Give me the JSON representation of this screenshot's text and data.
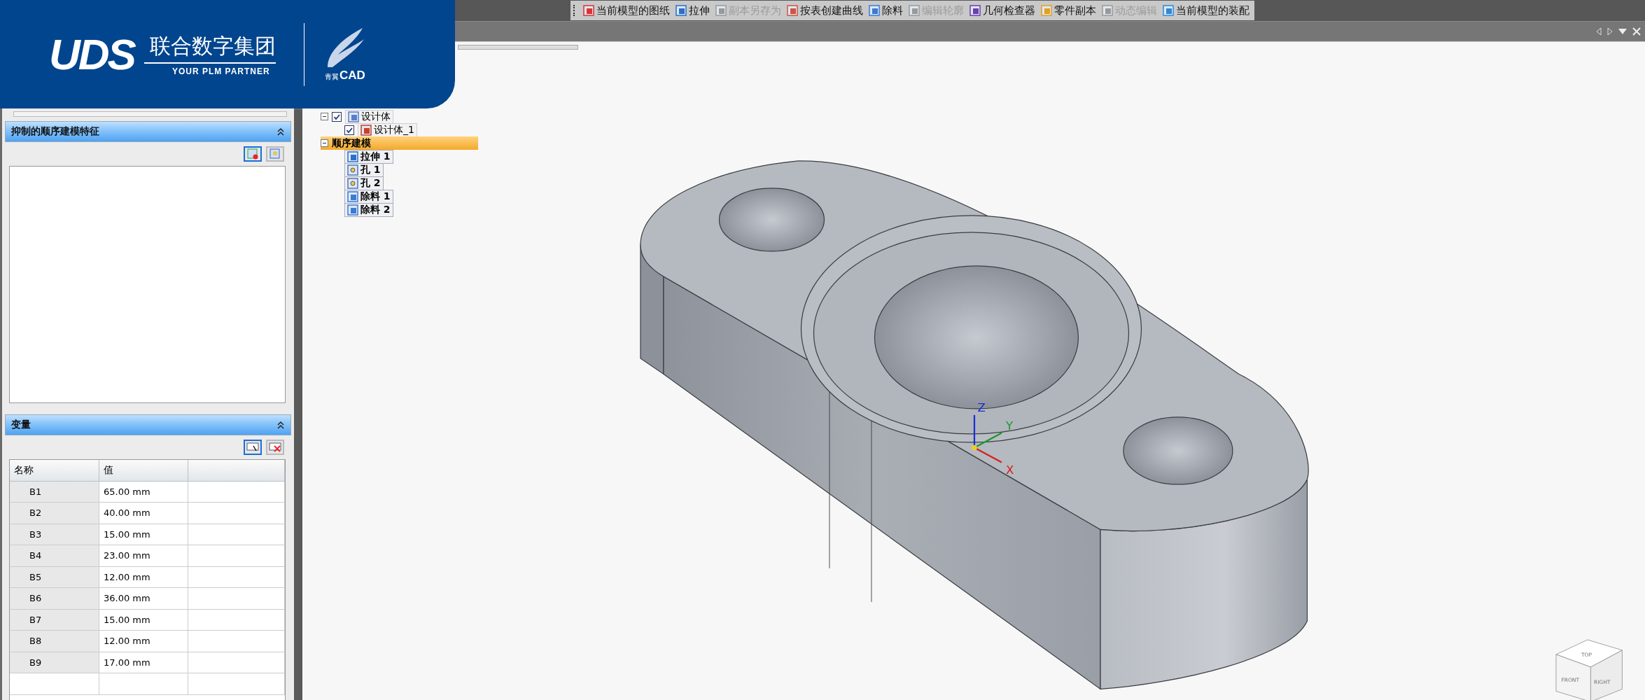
{
  "logo": {
    "mark": "UDS",
    "company": "联合数字集团",
    "tagline": "YOUR PLM PARTNER",
    "product_cn": "青翼",
    "product_en": "CAD"
  },
  "toolbar": [
    {
      "label": "当前模型的图纸",
      "kind": "drawing",
      "disabled": false
    },
    {
      "label": "拉伸",
      "kind": "extrude",
      "disabled": false
    },
    {
      "label": "副本另存为",
      "kind": "save",
      "disabled": true
    },
    {
      "label": "按表创建曲线",
      "kind": "curve",
      "disabled": false
    },
    {
      "label": "除料",
      "kind": "cut",
      "disabled": false
    },
    {
      "label": "编辑轮廓",
      "kind": "profile",
      "disabled": true
    },
    {
      "label": "几何检查器",
      "kind": "inspect",
      "disabled": false
    },
    {
      "label": "零件副本",
      "kind": "copy",
      "disabled": false
    },
    {
      "label": "动态编辑",
      "kind": "edit",
      "disabled": true
    },
    {
      "label": "当前模型的装配",
      "kind": "assembly",
      "disabled": false
    }
  ],
  "suppressed_panel": {
    "title": "抑制的顺序建模特征",
    "expanded": true
  },
  "variables_panel": {
    "title": "变量",
    "expanded": true,
    "columns": [
      "名称",
      "值"
    ],
    "rows": [
      {
        "name": "B1",
        "value": "65.00 mm"
      },
      {
        "name": "B2",
        "value": "40.00 mm"
      },
      {
        "name": "B3",
        "value": "15.00 mm"
      },
      {
        "name": "B4",
        "value": "23.00 mm"
      },
      {
        "name": "B5",
        "value": "12.00 mm"
      },
      {
        "name": "B6",
        "value": "36.00 mm"
      },
      {
        "name": "B7",
        "value": "15.00 mm"
      },
      {
        "name": "B8",
        "value": "12.00 mm"
      },
      {
        "name": "B9",
        "value": "17.00 mm"
      }
    ]
  },
  "tree": [
    {
      "label": "设计体",
      "kind": "body",
      "expanded": true,
      "checked": true,
      "selected": false,
      "children": [
        {
          "label": "设计体_1",
          "kind": "part",
          "checked": true,
          "selected": false
        }
      ]
    },
    {
      "label": "顺序建模",
      "kind": "group",
      "expanded": true,
      "selected": true,
      "children": [
        {
          "label": "拉伸 1",
          "kind": "extrude",
          "selected": false
        },
        {
          "label": "孔 1",
          "kind": "hole",
          "selected": false
        },
        {
          "label": "孔 2",
          "kind": "hole",
          "selected": false
        },
        {
          "label": "除料 1",
          "kind": "cut",
          "selected": false
        },
        {
          "label": "除料 2",
          "kind": "cut",
          "selected": false
        }
      ]
    }
  ],
  "axes": [
    "X",
    "Y",
    "Z"
  ],
  "view_cube": {
    "top": "TOP",
    "front": "FRONT",
    "right": "RIGHT"
  }
}
